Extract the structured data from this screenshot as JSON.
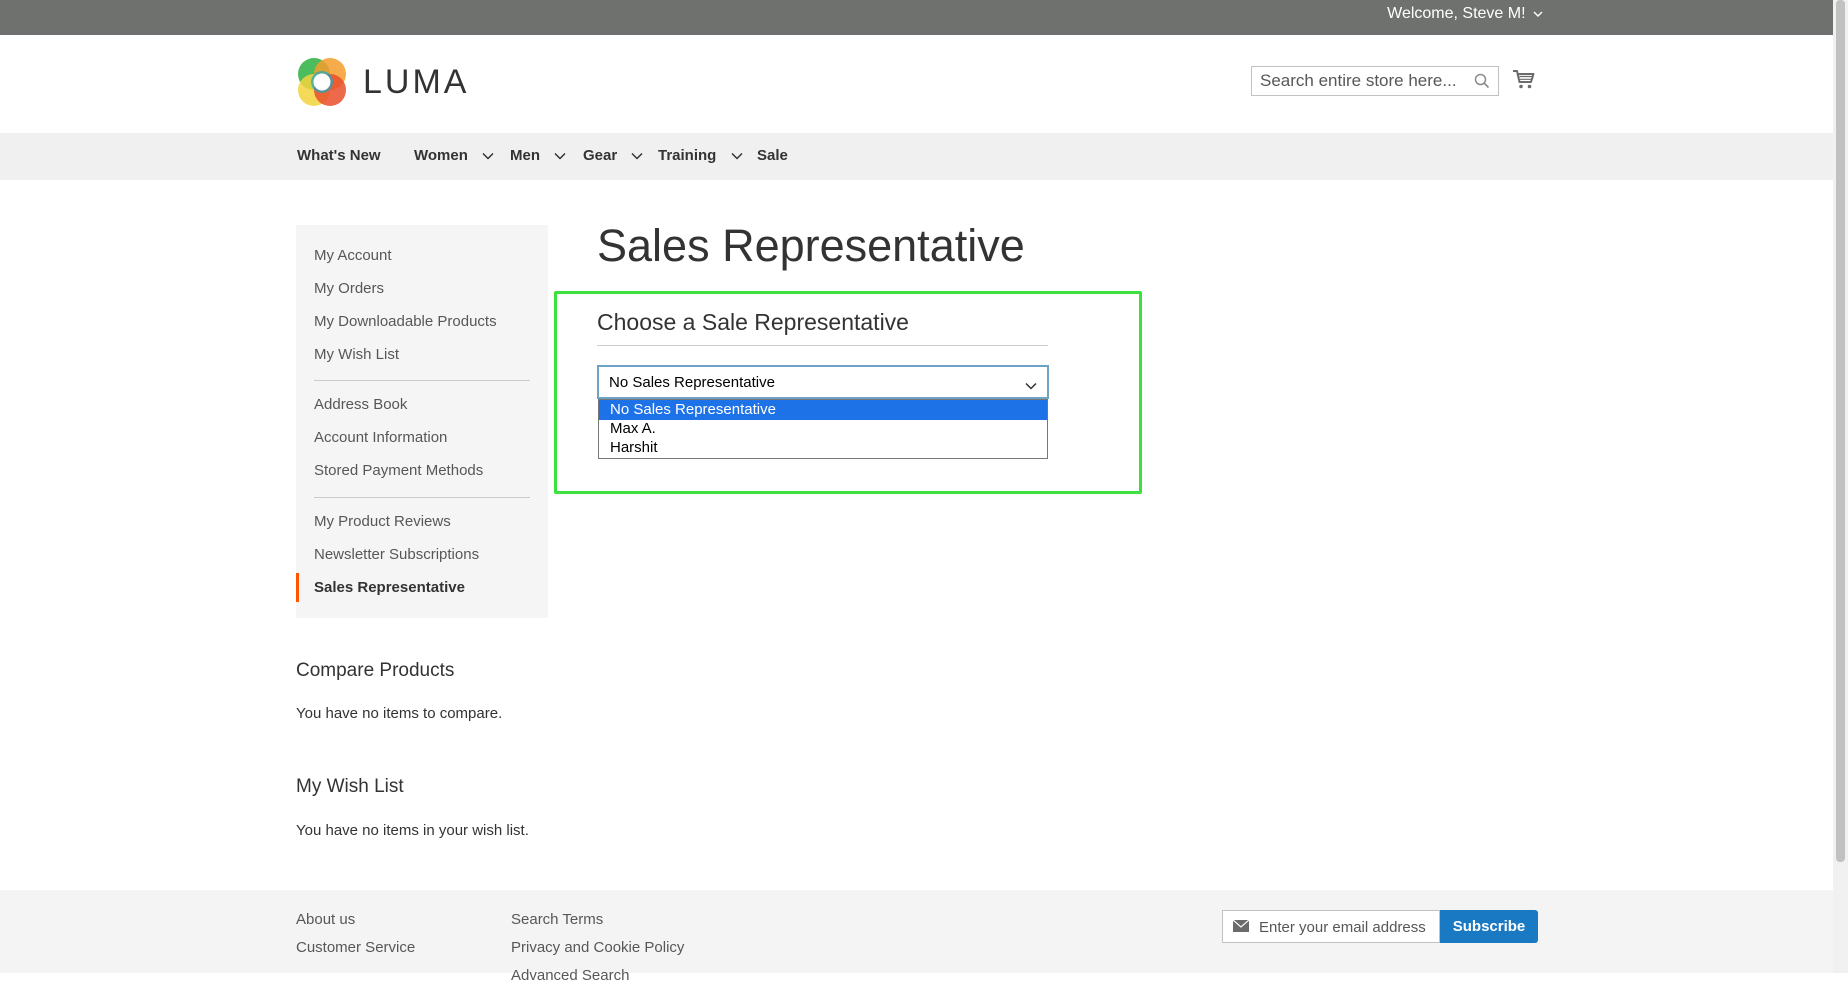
{
  "topbar": {
    "welcome": "Welcome, Steve M!"
  },
  "header": {
    "logo_text": "LUMA",
    "search_placeholder": "Search entire store here..."
  },
  "nav": {
    "items": [
      {
        "label": "What's New"
      },
      {
        "label": "Women"
      },
      {
        "label": "Men"
      },
      {
        "label": "Gear"
      },
      {
        "label": "Training"
      },
      {
        "label": "Sale"
      }
    ]
  },
  "sidebar": {
    "items": [
      {
        "label": "My Account"
      },
      {
        "label": "My Orders"
      },
      {
        "label": "My Downloadable Products"
      },
      {
        "label": "My Wish List"
      },
      {
        "label": "Address Book"
      },
      {
        "label": "Account Information"
      },
      {
        "label": "Stored Payment Methods"
      },
      {
        "label": "My Product Reviews"
      },
      {
        "label": "Newsletter Subscriptions"
      },
      {
        "label": "Sales Representative"
      }
    ],
    "accent_color": "#ff5501"
  },
  "main": {
    "title": "Sales Representative",
    "subtitle": "Choose a Sale Representative",
    "select_value": "No Sales Representative",
    "options": [
      {
        "label": "No Sales Representative"
      },
      {
        "label": "Max A."
      },
      {
        "label": "Harshit"
      }
    ],
    "highlight_color": "#3ce23c"
  },
  "compare": {
    "title": "Compare Products",
    "empty_text": "You have no items to compare."
  },
  "wishlist": {
    "title": "My Wish List",
    "empty_text": "You have no items in your wish list."
  },
  "footer": {
    "col1": [
      {
        "label": "About us"
      },
      {
        "label": "Customer Service"
      }
    ],
    "col2": [
      {
        "label": "Search Terms"
      },
      {
        "label": "Privacy and Cookie Policy"
      },
      {
        "label": "Advanced Search"
      }
    ],
    "email_placeholder": "Enter your email address",
    "subscribe_label": "Subscribe",
    "subscribe_color": "#1979c3"
  }
}
